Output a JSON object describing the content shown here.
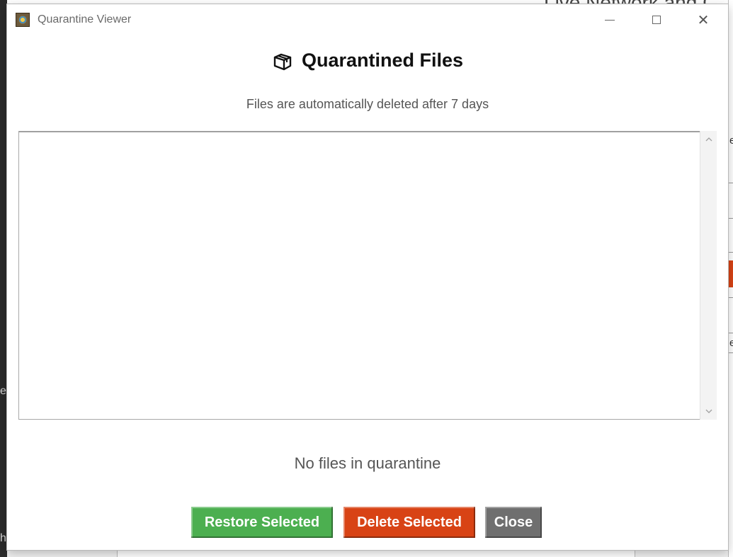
{
  "window": {
    "title": "Quarantine Viewer",
    "controls": {
      "minimize": "minimize-icon",
      "maximize": "maximize-icon",
      "close": "close-icon",
      "close_glyph": "✕"
    }
  },
  "header": {
    "title": "Quarantined Files",
    "icon": "package-icon",
    "subtitle": "Files are automatically deleted after 7 days"
  },
  "file_list": {
    "items": [],
    "scroll_up_icon": "chevron-up-icon",
    "scroll_down_icon": "chevron-down-icon"
  },
  "status": {
    "empty_message": "No files in quarantine"
  },
  "actions": {
    "restore_label": "Restore Selected",
    "delete_label": "Delete Selected",
    "close_label": "Close"
  },
  "colors": {
    "restore": "#4caf50",
    "delete": "#d84315",
    "close": "#6f6f6f"
  },
  "background": {
    "top_right_text": "Live Network and C",
    "left_fragments": [
      "es",
      "h"
    ],
    "right_fragments": [
      "e",
      "el"
    ]
  }
}
